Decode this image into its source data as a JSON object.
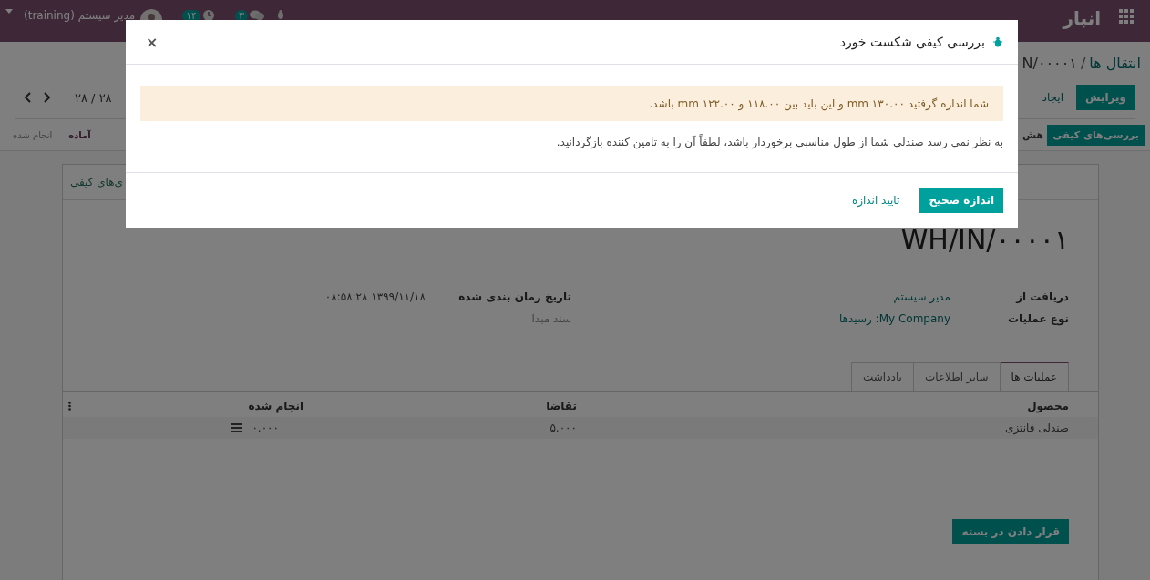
{
  "navbar": {
    "app_name": "انبار",
    "user": {
      "name": "مدیر سیستم (training)"
    },
    "badges": [
      {
        "kind": "chat",
        "count": "۳"
      },
      {
        "kind": "clock",
        "count": "۱۴"
      }
    ]
  },
  "breadcrumb": [
    {
      "label": "انتقال ها"
    },
    {
      "label": "N/۰۰۰۰۱"
    }
  ],
  "breadcrumb_separator": "/",
  "actions": [
    {
      "label": "ویرایش",
      "kind": "primary"
    },
    {
      "label": "ایجاد",
      "kind": "link"
    }
  ],
  "pager": {
    "text": "۲۸ / ۲۸"
  },
  "header_buttons": [
    "بررسی‌های کیفی",
    "هش"
  ],
  "statusbar": [
    {
      "label": "آماده",
      "selected": true
    },
    {
      "label": "انجام شده",
      "selected": false
    }
  ],
  "sheet": {
    "smart_button": "ی‌های کیفی",
    "title": "WH/IN/۰۰۰۰۱",
    "fields_right": [
      {
        "label": "دریافت از",
        "value": "مدیر سیستم"
      },
      {
        "label": "نوع عملیات",
        "value": "My Company: رسیدها"
      }
    ],
    "fields_left": [
      {
        "label": "تاریخ زمان بندی شده",
        "value": "۱۳۹۹/۱۱/۱۸ ۰۸:۵۸:۲۸",
        "kind": "field"
      },
      {
        "label": "سند مبدا",
        "kind": "muted"
      }
    ],
    "tabs": [
      {
        "label": "عملیات ها",
        "selected": true
      },
      {
        "label": "سایر اطلاعات",
        "selected": false
      },
      {
        "label": "یادداشت",
        "selected": false
      }
    ],
    "table": {
      "columns": [
        "محصول",
        "تقاضا",
        "انجام شده"
      ],
      "rows": [
        {
          "cells": [
            "صندلی فانتزی",
            "۵.۰۰۰",
            "۰.۰۰۰"
          ]
        }
      ]
    },
    "footer_button": "قرار دادن در بسته"
  },
  "dialog": {
    "title": "بررسی کیفی شکست خورد",
    "alert": "شما اندازه گرفتید ۱۳۰.۰۰ mm و این باید بین ۱۱۸.۰۰ و ۱۲۲.۰۰ mm باشد.",
    "message": "به نظر نمی رسد صندلی شما از طول مناسبی برخوردار باشد، لطفاً آن را به تامین کننده بازگردانید.",
    "close": "×",
    "buttons": [
      {
        "label": "اندازه صحیح",
        "kind": "primary"
      },
      {
        "label": "تایید اندازه",
        "kind": "link"
      }
    ]
  }
}
